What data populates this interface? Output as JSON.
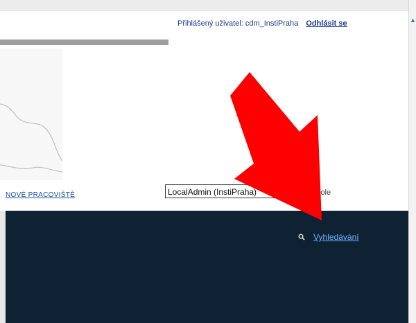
{
  "header": {
    "logged_user_text": "Přihlášený uživatel: cdm_InstiPraha",
    "logout_label": "Odhlásit se"
  },
  "toolbar": {
    "new_workplace_label": "NOVÉ PRACOVIŠTĚ",
    "role_select_value": "LocalAdmin (InstiPraha)",
    "role_label": "ktivní role"
  },
  "main": {
    "search_link_label": "Vyhledávání",
    "search_icon": "search-icon"
  },
  "annotation": {
    "arrow_color": "#ff0000",
    "arrow_target": "search-link"
  },
  "colors": {
    "dark_panel": "#0f2233",
    "link": "#1a4fa8",
    "search_link": "#6fb0ff"
  }
}
